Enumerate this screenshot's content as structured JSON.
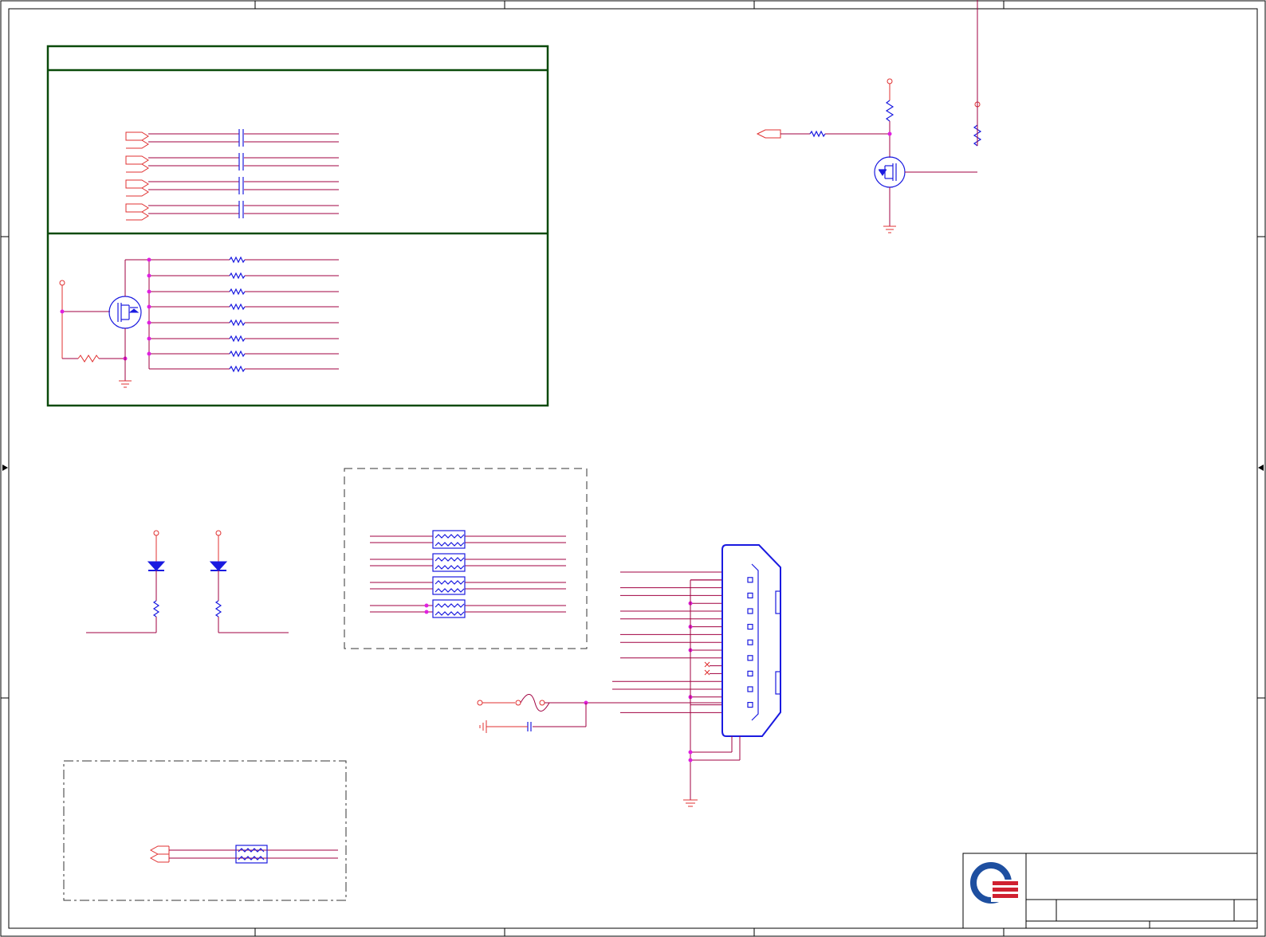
{
  "diagram": {
    "type": "schematic",
    "colors": {
      "wire": "#a00040",
      "symbol": "#1a1ae0",
      "junction": "#e020e0",
      "power_net": "#e03030",
      "block_border": "#0a4a0a",
      "logo_blue": "#1e4fa0",
      "logo_red": "#d02030"
    },
    "title_block": {
      "logo_icon": "company-logo-icon"
    }
  }
}
